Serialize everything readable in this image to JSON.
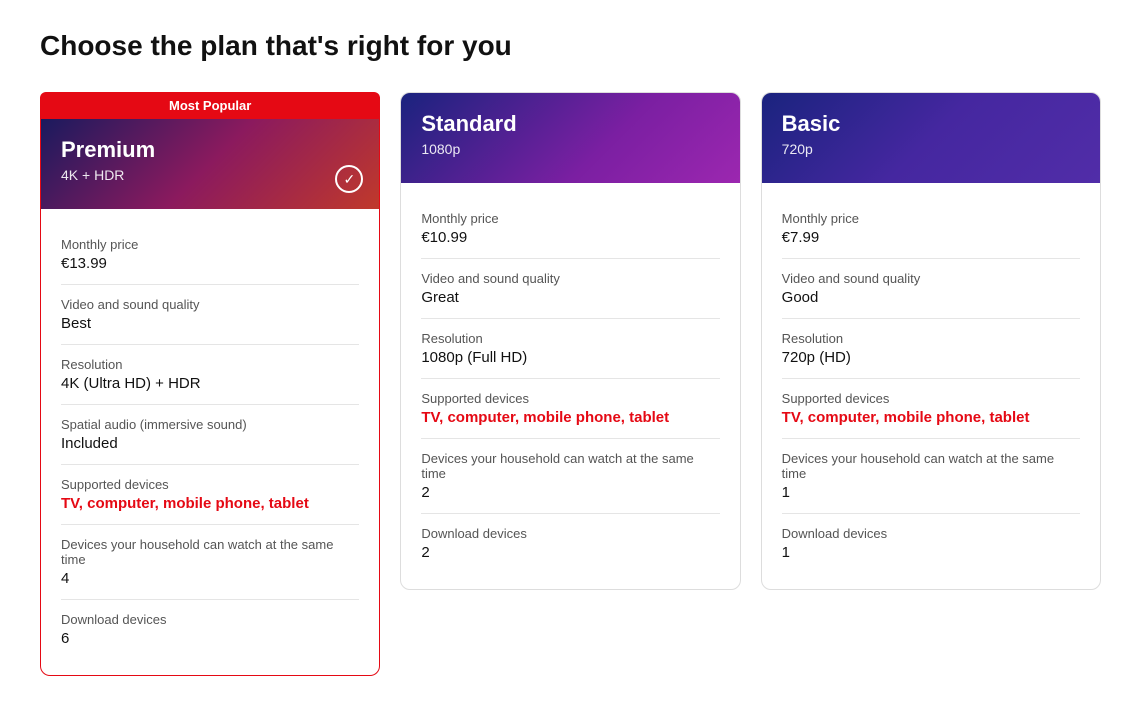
{
  "page": {
    "title": "Choose the plan that's right for you"
  },
  "plans": [
    {
      "id": "premium",
      "name": "Premium",
      "resolution_label": "4K + HDR",
      "badge": "Most Popular",
      "selected": true,
      "header_class": "premium",
      "monthly_price_label": "Monthly price",
      "monthly_price": "€13.99",
      "video_quality_label": "Video and sound quality",
      "video_quality": "Best",
      "resolution_row_label": "Resolution",
      "resolution_row": "4K (Ultra HD) + HDR",
      "spatial_audio_label": "Spatial audio (immersive sound)",
      "spatial_audio": "Included",
      "supported_devices_label": "Supported devices",
      "supported_devices": "TV, computer, mobile phone, tablet",
      "simultaneous_label": "Devices your household can watch at the same time",
      "simultaneous": "4",
      "download_label": "Download devices",
      "download": "6"
    },
    {
      "id": "standard",
      "name": "Standard",
      "resolution_label": "1080p",
      "badge": null,
      "selected": false,
      "header_class": "standard",
      "monthly_price_label": "Monthly price",
      "monthly_price": "€10.99",
      "video_quality_label": "Video and sound quality",
      "video_quality": "Great",
      "resolution_row_label": "Resolution",
      "resolution_row": "1080p (Full HD)",
      "spatial_audio_label": null,
      "spatial_audio": null,
      "supported_devices_label": "Supported devices",
      "supported_devices": "TV, computer, mobile phone, tablet",
      "simultaneous_label": "Devices your household can watch at the same time",
      "simultaneous": "2",
      "download_label": "Download devices",
      "download": "2"
    },
    {
      "id": "basic",
      "name": "Basic",
      "resolution_label": "720p",
      "badge": null,
      "selected": false,
      "header_class": "basic",
      "monthly_price_label": "Monthly price",
      "monthly_price": "€7.99",
      "video_quality_label": "Video and sound quality",
      "video_quality": "Good",
      "resolution_row_label": "Resolution",
      "resolution_row": "720p (HD)",
      "spatial_audio_label": null,
      "spatial_audio": null,
      "supported_devices_label": "Supported devices",
      "supported_devices": "TV, computer, mobile phone, tablet",
      "simultaneous_label": "Devices your household can watch at the same time",
      "simultaneous": "1",
      "download_label": "Download devices",
      "download": "1"
    }
  ]
}
